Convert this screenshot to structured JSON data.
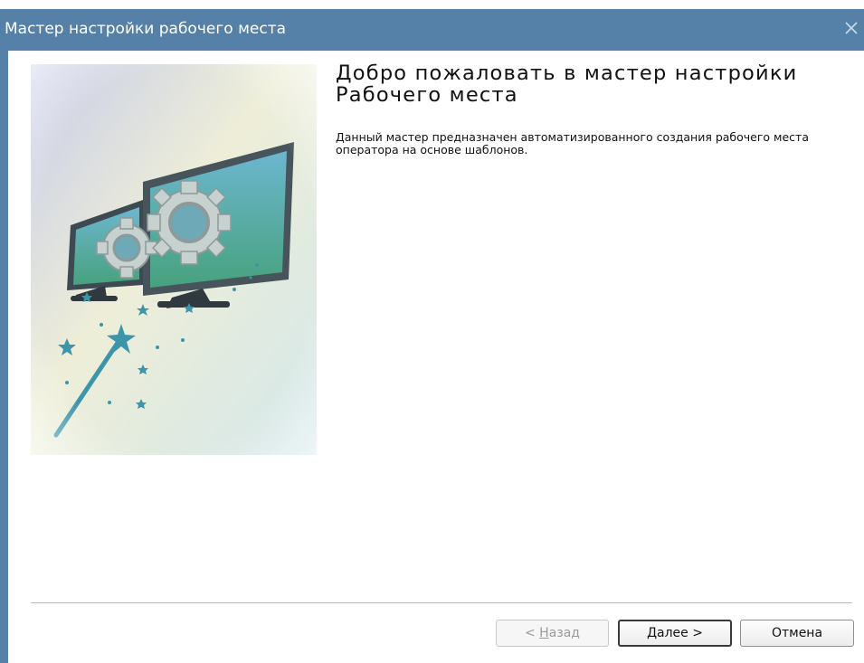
{
  "window": {
    "title": "Мастер настройки рабочего места",
    "close_icon": "close-icon"
  },
  "content": {
    "heading": "Добро пожаловать в мастер настройки Рабочего места",
    "description": "Данный мастер предназначен автоматизированного создания рабочего места оператора на основе шаблонов."
  },
  "illustration": {
    "icons": [
      "monitor-icon",
      "gear-icon",
      "magic-wand-icon",
      "star-icon"
    ]
  },
  "buttons": {
    "back": {
      "prefix": "< ",
      "mnemonic": "Н",
      "rest": "азад",
      "enabled": false
    },
    "next": {
      "mnemonic": "Д",
      "rest": "алее >",
      "enabled": true
    },
    "cancel": {
      "label": "Отмена",
      "enabled": true
    }
  },
  "colors": {
    "titlebar": "#5581a8",
    "accent_teal": "#4fa3b4"
  }
}
